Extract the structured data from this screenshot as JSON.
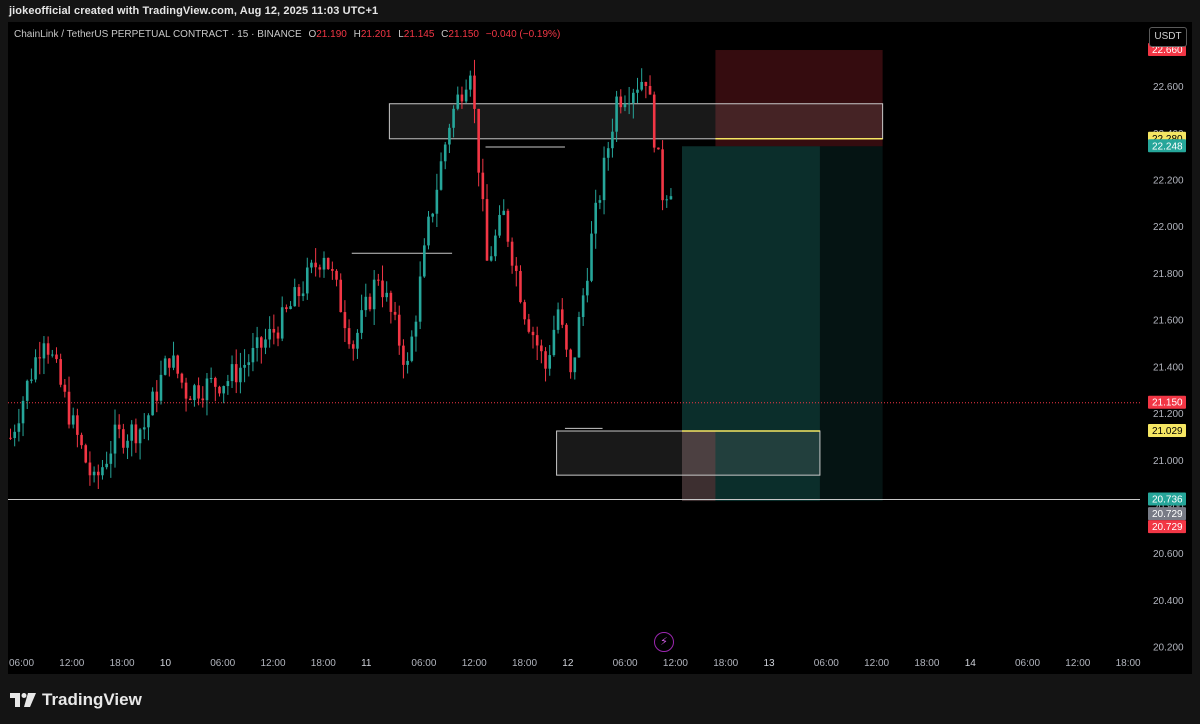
{
  "caption": "jiokeofficial created with TradingView.com, Aug 12, 2025 11:03 UTC+1",
  "legend": {
    "symbol": "ChainLink / TetherUS PERPETUAL CONTRACT · 15 · BINANCE",
    "open_label": "O",
    "open": "21.190",
    "high_label": "H",
    "high": "21.201",
    "low_label": "L",
    "low": "21.145",
    "close_label": "C",
    "close": "21.150",
    "change": "−0.040 (−0.19%)"
  },
  "currency_button": "USDT",
  "brand": {
    "name": "TradingView",
    "icon": "tradingview-logo-icon"
  },
  "flash_icon": "lightning-icon",
  "colors": {
    "up": "#26a69a",
    "down": "#f23645",
    "highlight_yellow": "#f5e663",
    "grey_label": "#787b86"
  },
  "chart_data": {
    "type": "candlestick",
    "symbol": "LINKUSDT.P",
    "interval": "15",
    "y_range": [
      20.1,
      22.78
    ],
    "price_ticks": [
      "22.600",
      "22.400",
      "22.200",
      "22.000",
      "21.800",
      "21.600",
      "21.400",
      "21.200",
      "21.000",
      "20.800",
      "20.600",
      "20.400",
      "20.200"
    ],
    "price_tick_values": [
      22.6,
      22.4,
      22.2,
      22.0,
      21.8,
      21.6,
      21.4,
      21.2,
      21.0,
      20.8,
      20.6,
      20.4,
      20.2
    ],
    "price_labels": [
      {
        "text": "22.660",
        "value": 22.66,
        "kind": "red"
      },
      {
        "text": "22.280",
        "value": 22.28,
        "kind": "yellow"
      },
      {
        "text": "22.248",
        "value": 22.248,
        "kind": "green"
      },
      {
        "text": "21.150",
        "value": 21.15,
        "kind": "red"
      },
      {
        "text": "21.029",
        "value": 21.029,
        "kind": "yellow"
      },
      {
        "text": "20.736",
        "value": 20.736,
        "kind": "green"
      },
      {
        "text": "20.729",
        "value": 20.729,
        "kind": "grey"
      },
      {
        "text": "20.729",
        "value": 20.729,
        "kind": "red"
      }
    ],
    "time_ticks": [
      "06:00",
      "12:00",
      "18:00",
      "10",
      "06:00",
      "12:00",
      "18:00",
      "11",
      "06:00",
      "12:00",
      "18:00",
      "12",
      "06:00",
      "12:00",
      "18:00",
      "13",
      "06:00",
      "12:00",
      "18:00",
      "14",
      "06:00",
      "12:00",
      "18:00"
    ],
    "time_tick_bold": [
      false,
      false,
      false,
      true,
      false,
      false,
      false,
      true,
      false,
      false,
      false,
      true,
      false,
      false,
      false,
      true,
      false,
      false,
      false,
      true,
      false,
      false,
      false
    ],
    "bars_visible": 264,
    "bars_per_tick": 24,
    "anchors": [
      [
        0,
        21.0
      ],
      [
        8,
        21.45
      ],
      [
        15,
        21.05
      ],
      [
        20,
        20.8
      ],
      [
        25,
        21.0
      ],
      [
        32,
        21.05
      ],
      [
        38,
        21.35
      ],
      [
        42,
        21.2
      ],
      [
        52,
        21.25
      ],
      [
        58,
        21.35
      ],
      [
        65,
        21.5
      ],
      [
        75,
        21.8
      ],
      [
        82,
        21.4
      ],
      [
        88,
        21.7
      ],
      [
        95,
        21.3
      ],
      [
        100,
        21.9
      ],
      [
        105,
        22.35
      ],
      [
        110,
        22.6
      ],
      [
        114,
        21.75
      ],
      [
        118,
        21.95
      ],
      [
        123,
        21.55
      ],
      [
        128,
        21.3
      ],
      [
        131,
        21.55
      ],
      [
        134,
        21.25
      ],
      [
        139,
        21.85
      ],
      [
        145,
        22.45
      ],
      [
        152,
        22.55
      ],
      [
        156,
        22.05
      ],
      [
        162,
        22.15
      ],
      [
        168,
        21.95
      ],
      [
        174,
        22.1
      ],
      [
        180,
        22.0
      ],
      [
        186,
        22.35
      ],
      [
        191,
        22.45
      ],
      [
        195,
        22.2
      ],
      [
        200,
        22.05
      ],
      [
        206,
        22.1
      ],
      [
        212,
        21.9
      ],
      [
        218,
        21.7
      ],
      [
        224,
        21.45
      ],
      [
        229,
        21.3
      ],
      [
        234,
        21.6
      ],
      [
        238,
        21.75
      ],
      [
        242,
        21.85
      ],
      [
        247,
        21.95
      ],
      [
        252,
        21.75
      ],
      [
        257,
        21.5
      ],
      [
        262,
        21.4
      ],
      [
        266,
        21.45
      ],
      [
        270,
        21.3
      ],
      [
        274,
        21.2
      ],
      [
        278,
        21.05
      ],
      [
        282,
        21.15
      ],
      [
        286,
        21.2
      ],
      [
        290,
        21.5
      ],
      [
        294,
        21.6
      ],
      [
        298,
        21.4
      ],
      [
        302,
        21.55
      ],
      [
        306,
        21.45
      ],
      [
        310,
        21.6
      ],
      [
        313,
        21.25
      ],
      [
        315,
        21.15
      ]
    ],
    "levels": [
      {
        "name": "current-price",
        "value": 21.15,
        "style": "dotted-red"
      },
      {
        "name": "support-line",
        "value": 20.736,
        "style": "solid-grey"
      }
    ],
    "zones": [
      {
        "name": "supply-zone",
        "top": 22.43,
        "bottom": 22.28
      },
      {
        "name": "demand-zone",
        "top": 21.029,
        "bottom": 20.84
      }
    ],
    "position": {
      "entry": 22.248,
      "stop": 22.66,
      "target": 20.729
    },
    "grid": false
  }
}
